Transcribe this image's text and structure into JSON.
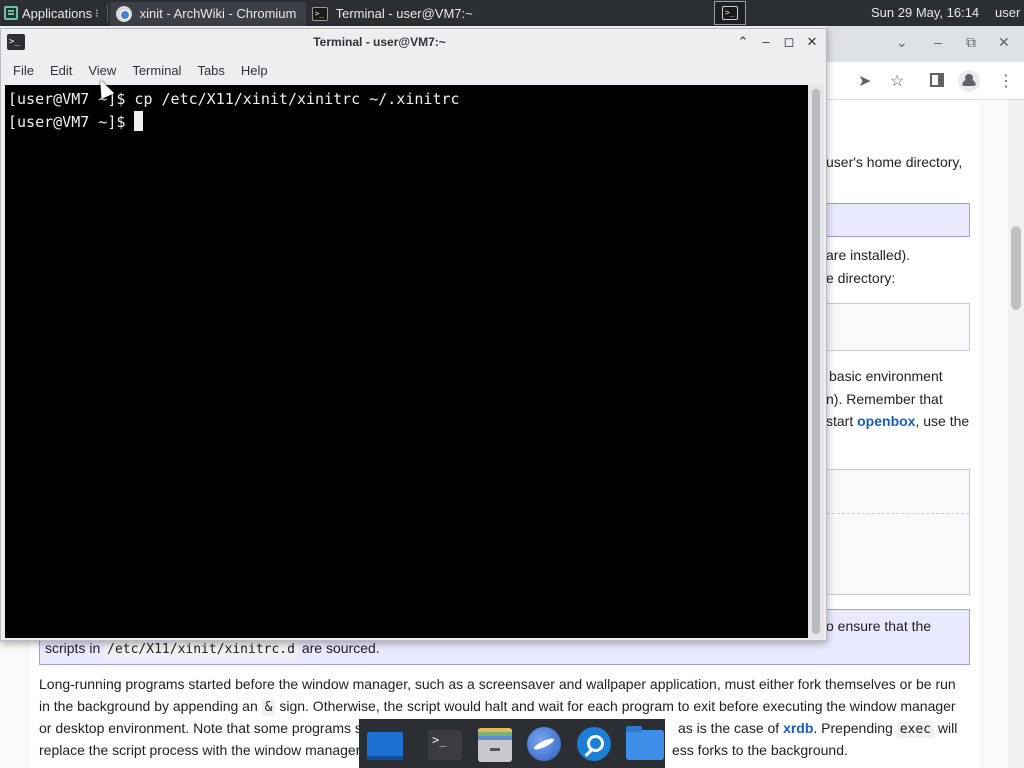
{
  "panel": {
    "applications_label": "Applications",
    "tasks": [
      {
        "label": "xinit - ArchWiki - Chromium",
        "icon": "chromium-icon"
      },
      {
        "label": "Terminal - user@VM7:~",
        "icon": "terminal-icon"
      }
    ],
    "clock": "Sun 29 May, 16:14",
    "user": "user"
  },
  "terminal": {
    "title": "Terminal - user@VM7:~",
    "menu": [
      "File",
      "Edit",
      "View",
      "Terminal",
      "Tabs",
      "Help"
    ],
    "lines": [
      "[user@VM7 ~]$ cp /etc/X11/xinit/xinitrc ~/.xinitrc",
      "[user@VM7 ~]$ "
    ]
  },
  "browser": {
    "controls": {
      "minimize": "–",
      "maximize": "⧉",
      "close": "✕",
      "dropdown": "⌄"
    },
    "article": {
      "frag_home_dir": "user's home directory,",
      "frag_installed": "are installed).",
      "frag_directory": "e directory:",
      "frag_basic_env": "basic environment",
      "frag_remember": "n). Remember that",
      "frag_start": "start",
      "link_openbox": "openbox",
      "frag_use_the": ", use the",
      "note_frag_ensure": "o ensure that the",
      "note_scripts_in": "scripts in",
      "note_code_path": "/etc/X11/xinit/xinitrc.d",
      "note_are_sourced": "are sourced.",
      "para_line1": "Long-running programs started before the window manager, such as a screensaver and wallpaper application, must either fork themselves or be run",
      "para_line2_a": "in the background by appending an",
      "para_line2_code": "&",
      "para_line2_b": "sign. Otherwise, the script would halt and wait for each program to exit before executing the window manager",
      "para_line3_a": "or desktop environment. Note that some programs s",
      "para_line3_b": "as is the case of",
      "link_xrdb": "xrdb",
      "para_line3_c": ". Prepending",
      "para_line3_code": "exec",
      "para_line3_d": "will",
      "para_line4_a": "replace the script process with the window manager",
      "para_line4_b": "ess forks to the background."
    }
  },
  "dock": {
    "items": [
      "desktop-icon",
      "terminal-icon",
      "file-cabinet-icon",
      "web-browser-icon",
      "search-icon",
      "folder-icon"
    ]
  }
}
